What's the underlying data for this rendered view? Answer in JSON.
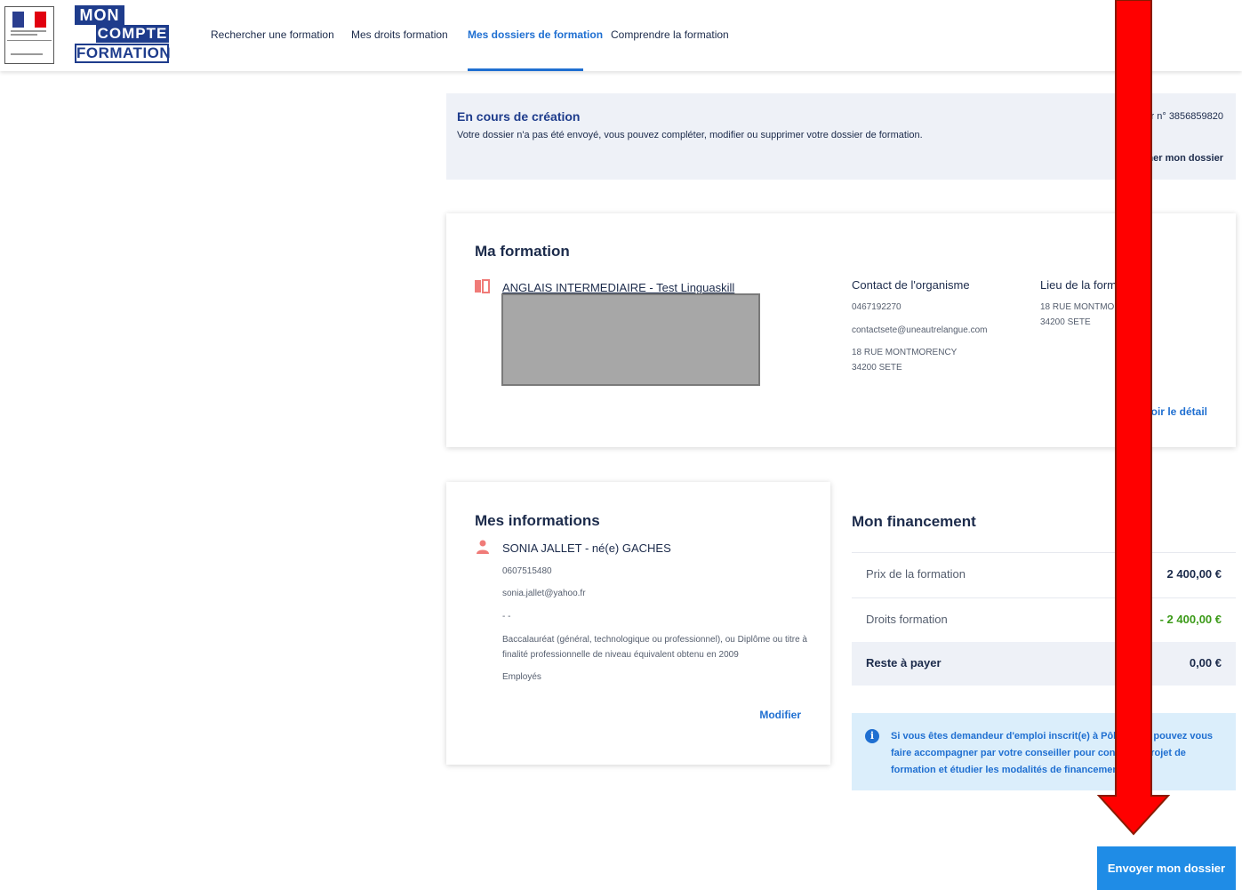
{
  "header": {
    "nav": [
      {
        "label": "Rechercher une formation",
        "active": false
      },
      {
        "label": "Mes droits formation",
        "active": false
      },
      {
        "label": "Mes dossiers de formation",
        "active": true
      },
      {
        "label": "Comprendre la formation",
        "active": false
      }
    ],
    "logo": {
      "mon": "MON",
      "compte": "COMPTE",
      "formation": "FORMATION"
    }
  },
  "status": {
    "title": "En cours de création",
    "description": "Votre dossier n'a pas été envoyé, vous pouvez compléter, modifier ou supprimer votre dossier de formation.",
    "dossier_number": "er n° 3856859820",
    "delete_label": "primer mon dossier"
  },
  "formation": {
    "title": "Ma formation",
    "name": "ANGLAIS INTERMEDIAIRE - Test Linguaskill",
    "contact": {
      "heading": "Contact de l'organisme",
      "phone": "0467192270",
      "email": "contactsete@uneautrelangue.com",
      "address_line1": "18 RUE MONTMORENCY",
      "address_line2": "34200 SETE"
    },
    "lieu": {
      "heading": "Lieu de la forma",
      "address_line1": "18 RUE MONTMOR",
      "address_line2": "34200 SETE"
    },
    "detail_link": "Voir le détail"
  },
  "informations": {
    "title": "Mes informations",
    "name": "SONIA JALLET - né(e) GACHES",
    "phone": "0607515480",
    "email": "sonia.jallet@yahoo.fr",
    "address": "- -",
    "diploma": "Baccalauréat (général, technologique ou professionnel), ou Diplôme ou titre à finalité professionnelle de niveau équivalent obtenu en 2009",
    "category": "Employés",
    "modify_label": "Modifier"
  },
  "financement": {
    "title": "Mon financement",
    "rows": [
      {
        "label": "Prix de la formation",
        "value": "2 400,00 €"
      },
      {
        "label": "Droits formation",
        "value": "- 2 400,00 €"
      },
      {
        "label": "Reste à payer",
        "value": "0,00 €"
      }
    ],
    "info_text": "Si vous êtes demandeur d'emploi inscrit(e) à Pôle E ous pouvez vous faire accompagner par votre conseiller pour constru e projet de formation et étudier les modalités de financements lles."
  },
  "actions": {
    "send_label": "Envoyer mon dossier"
  },
  "colors": {
    "primary": "#1e3c8c",
    "link": "#1f6fd1",
    "button": "#1f8ce6",
    "green": "#3b9a18",
    "arrow": "#ff0000"
  },
  "icons": [
    "book-icon",
    "user-icon",
    "info-icon",
    "red-arrow-annotation"
  ]
}
